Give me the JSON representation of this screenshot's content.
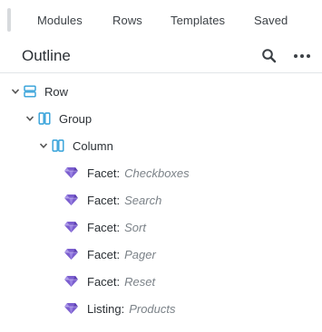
{
  "tabs": [
    "Modules",
    "Rows",
    "Templates",
    "Saved"
  ],
  "outline": {
    "title": "Outline"
  },
  "tree": {
    "row": {
      "label": "Row"
    },
    "group": {
      "label": "Group"
    },
    "column": {
      "label": "Column"
    },
    "modules": [
      {
        "type": "Facet:",
        "name": "Checkboxes"
      },
      {
        "type": "Facet:",
        "name": "Search"
      },
      {
        "type": "Facet:",
        "name": "Sort"
      },
      {
        "type": "Facet:",
        "name": "Pager"
      },
      {
        "type": "Facet:",
        "name": "Reset"
      },
      {
        "type": "Listing:",
        "name": "Products"
      }
    ]
  },
  "icons": {
    "search": "search-icon",
    "more": "more-horizontal-icon",
    "row": "row-layout-icon",
    "column": "column-layout-icon",
    "module": "gem-icon",
    "chevron": "chevron-down-icon"
  },
  "colors": {
    "accent": "#2f9fd8",
    "gem": "#7b5ecf",
    "muted": "#7b8288"
  }
}
